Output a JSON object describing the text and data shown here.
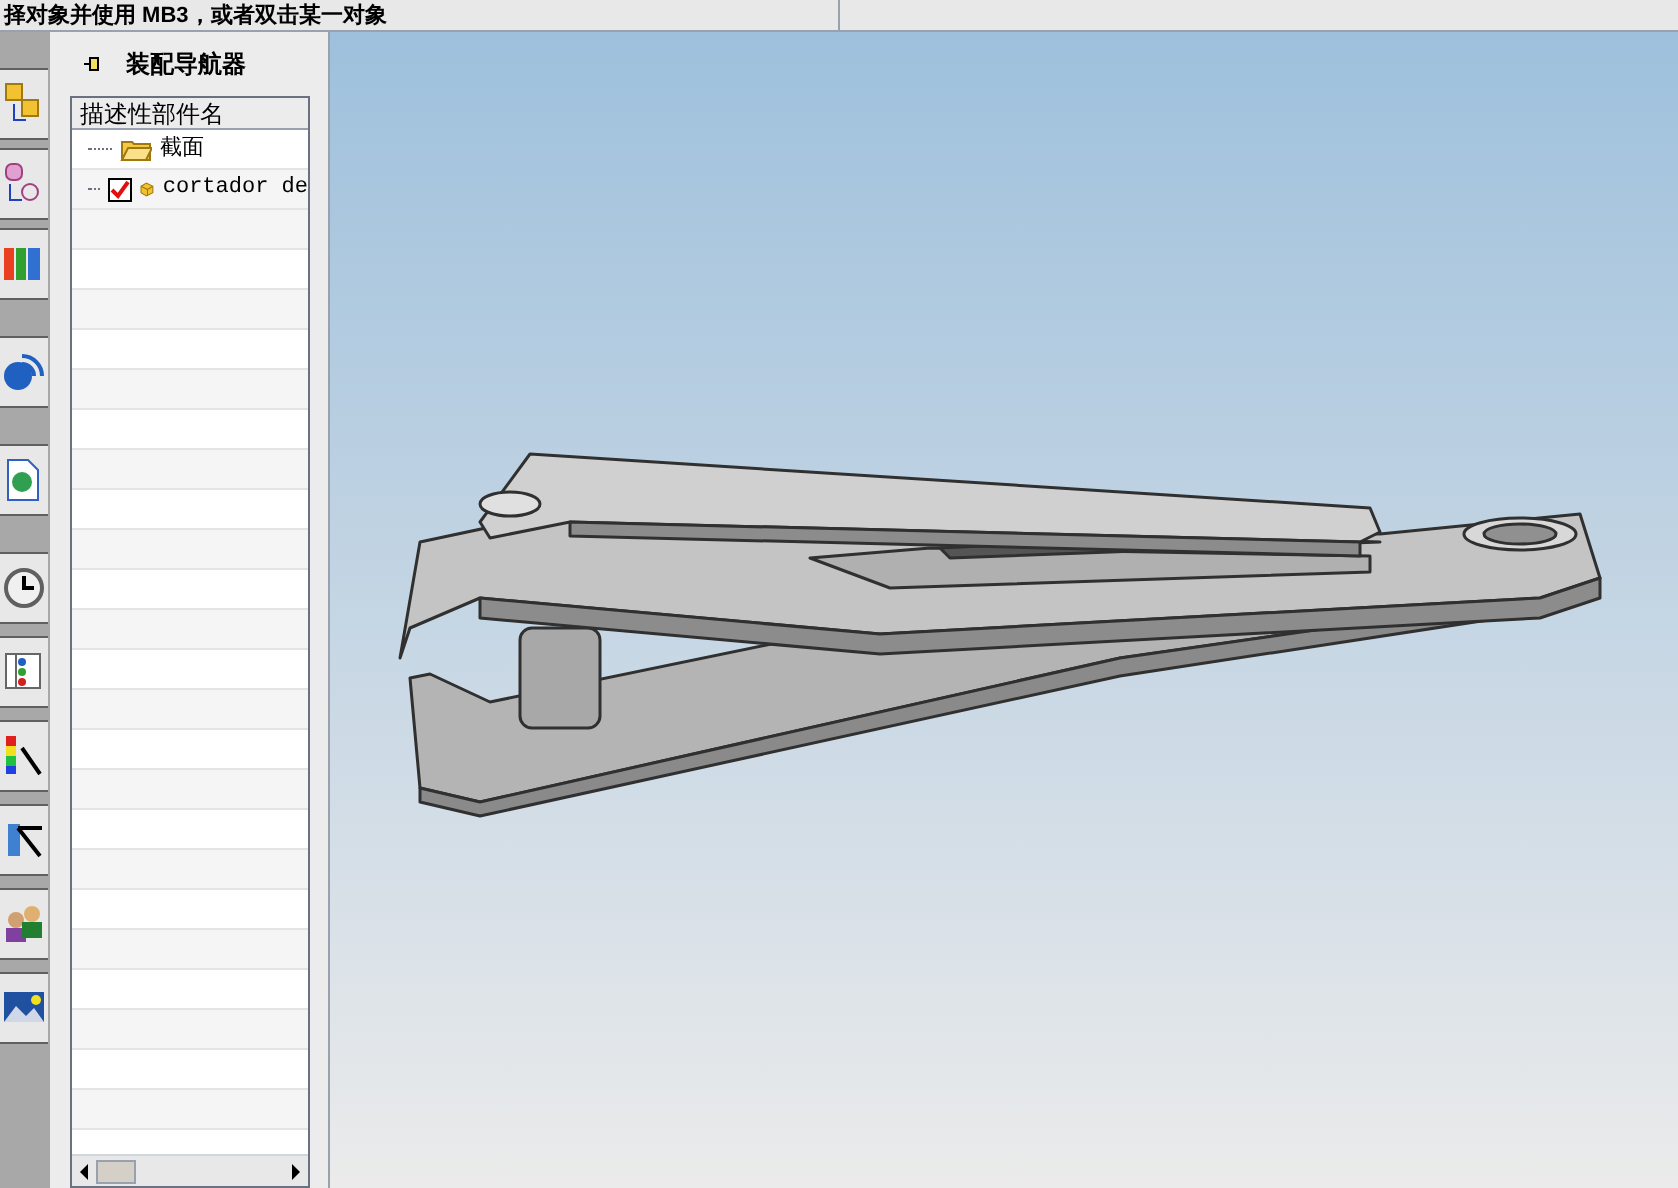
{
  "status_bar": {
    "prompt": "择对象并使用 MB3，或者双击某一对象"
  },
  "navigator": {
    "title": "装配导航器",
    "column": "描述性部件名",
    "tree": [
      {
        "label": "截面",
        "kind": "folder"
      },
      {
        "label": "cortador de",
        "kind": "part",
        "checked": true
      }
    ]
  }
}
